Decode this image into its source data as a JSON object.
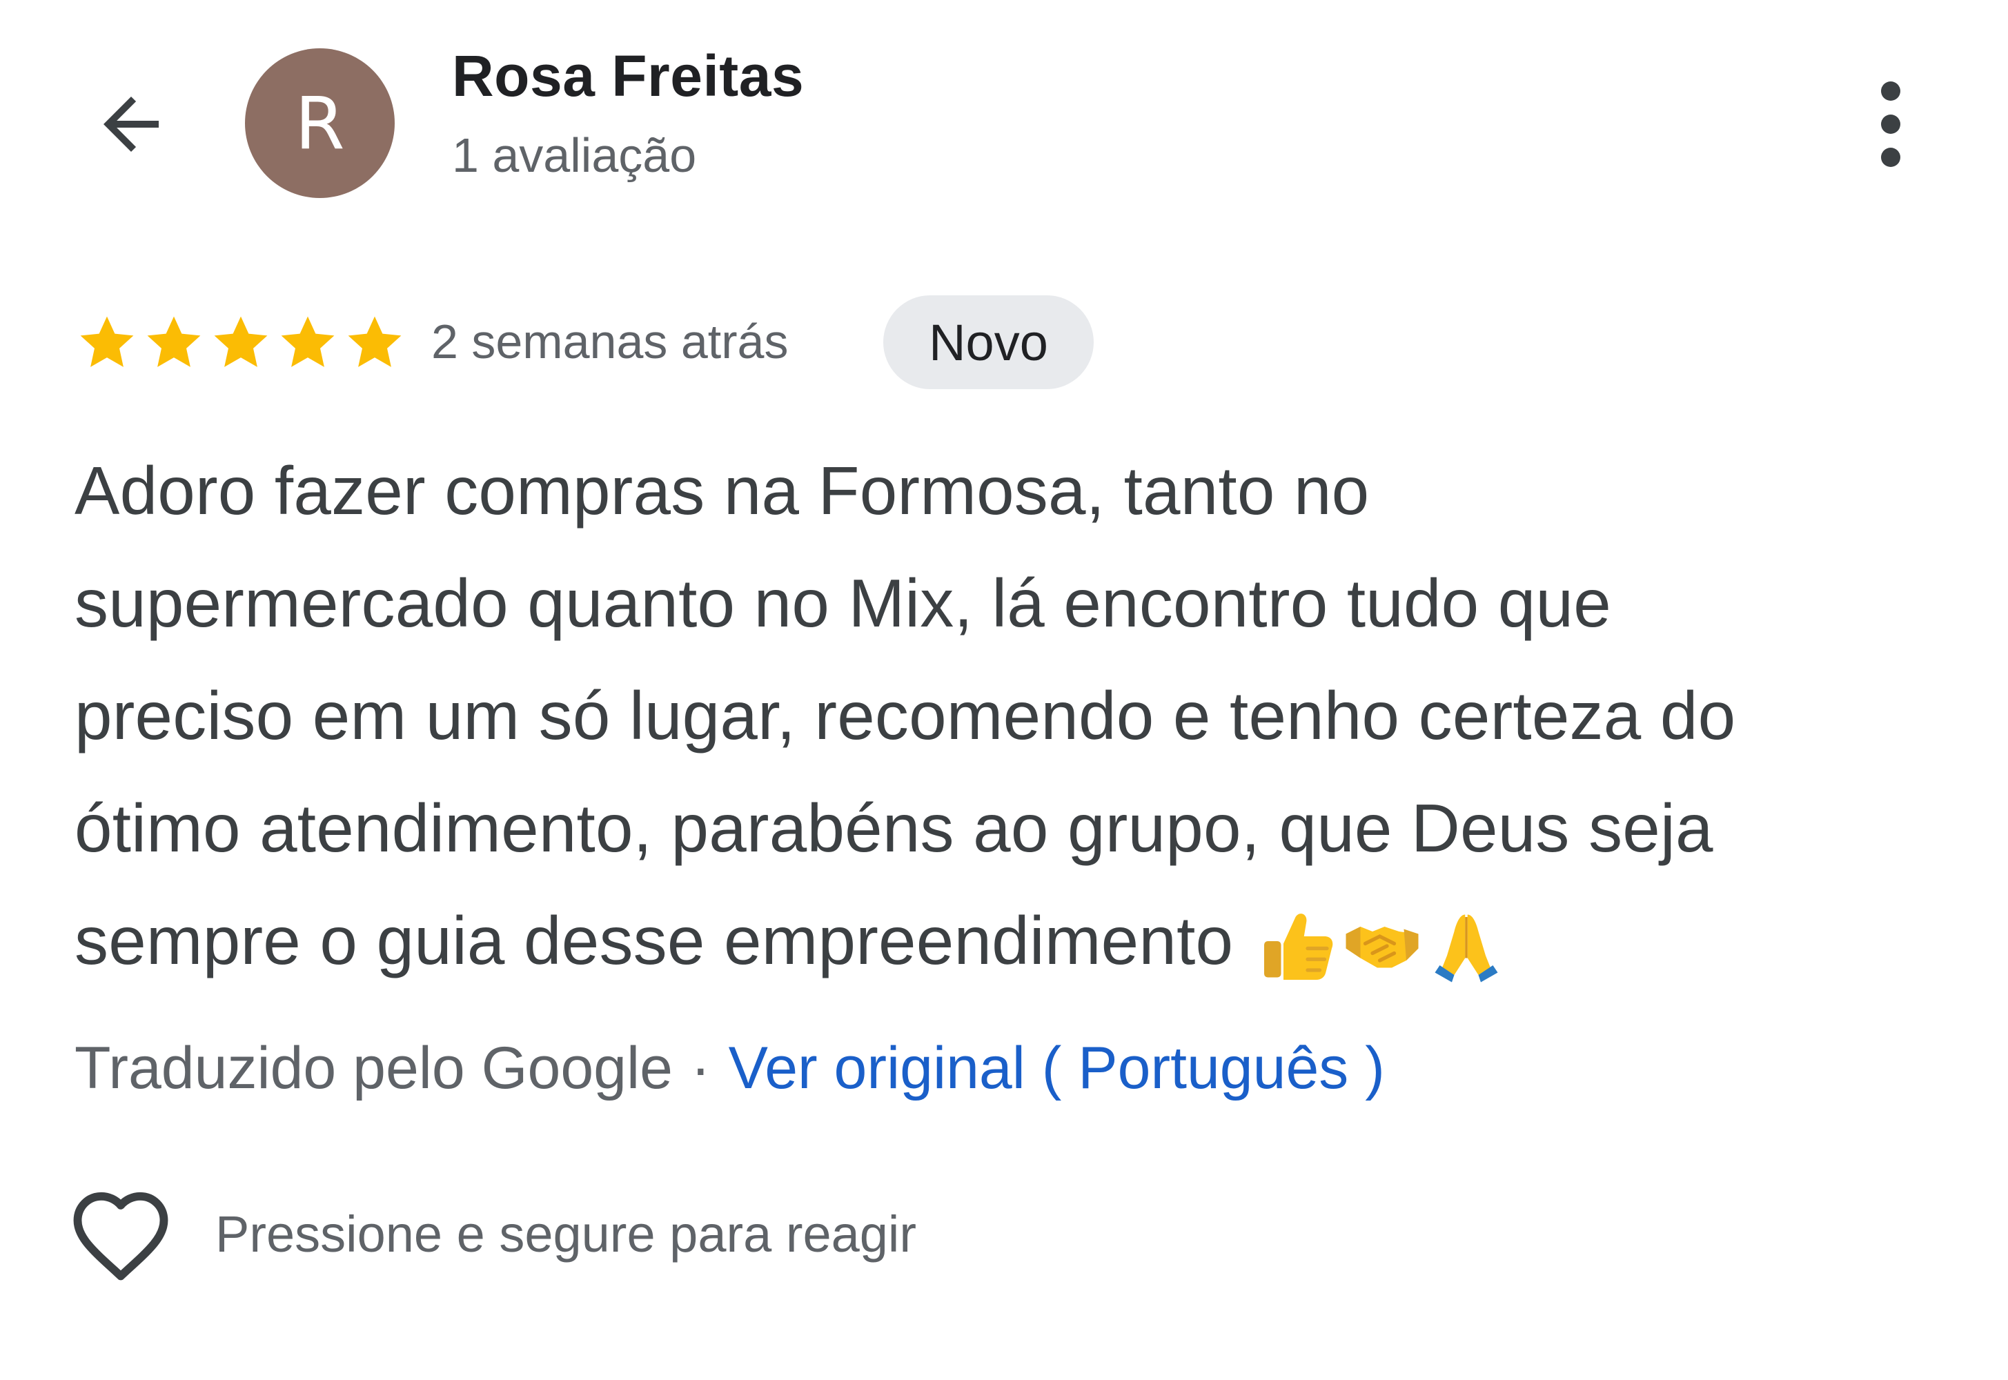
{
  "header": {
    "back_icon": "arrow-left-icon",
    "avatar_letter": "R",
    "avatar_color": "#8d6e63",
    "user_name": "Rosa Freitas",
    "review_count": "1 avaliação",
    "more_icon": "more-vertical-icon"
  },
  "review": {
    "rating": 5,
    "max_rating": 5,
    "star_color": "#fbbc04",
    "date": "2 semanas atrás",
    "badge": "Novo",
    "text_lines": [
      "Adoro fazer compras na Formosa, tanto no",
      "supermercado quanto no Mix, lá encontro tudo que",
      "preciso em um só lugar, recomendo e tenho certeza do",
      "ótimo atendimento, parabéns ao grupo, que Deus seja",
      "sempre o guia desse empreendimento"
    ],
    "emojis": [
      "thumbs-up-icon",
      "handshake-icon",
      "folded-hands-icon"
    ]
  },
  "translation": {
    "translated_by": "Traduzido pelo Google",
    "separator": "·",
    "view_original": "Ver original ( Português )",
    "link_color": "#1a5fc9"
  },
  "reaction": {
    "heart_icon": "heart-outline-icon",
    "hint": "Pressione e segure para reagir"
  }
}
